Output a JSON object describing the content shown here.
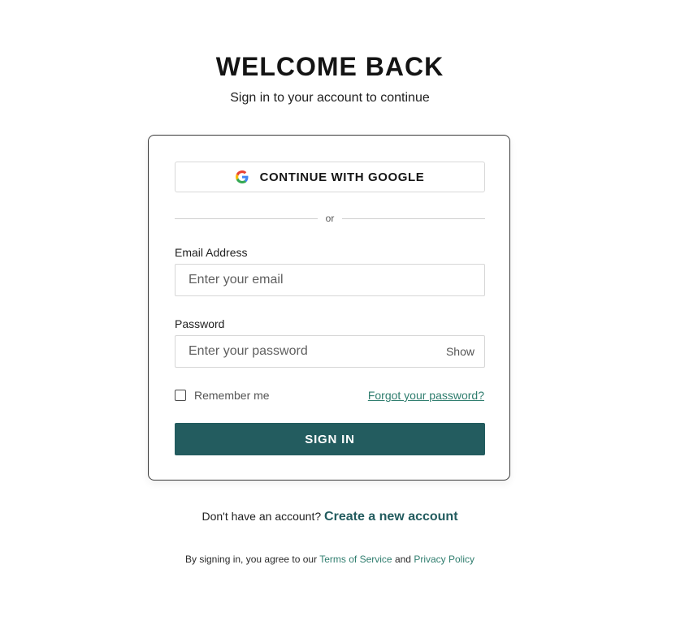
{
  "header": {
    "title": "WELCOME BACK",
    "subtitle": "Sign in to your account to continue"
  },
  "card": {
    "google_button_label": "CONTINUE WITH GOOGLE",
    "divider_text": "or",
    "email": {
      "label": "Email Address",
      "placeholder": "Enter your email"
    },
    "password": {
      "label": "Password",
      "placeholder": "Enter your password",
      "toggle_label": "Show"
    },
    "remember_label": "Remember me",
    "forgot_label": "Forgot your password?",
    "sign_in_label": "SIGN IN"
  },
  "footer": {
    "no_account_text": "Don't have an account?",
    "create_account_label": "Create a new account",
    "legal_prefix": "By signing in, you agree to our",
    "terms_label": "Terms of Service",
    "legal_and": "and",
    "privacy_label": "Privacy Policy"
  },
  "colors": {
    "primary": "#235c5f",
    "link": "#2f7d6e",
    "text": "#1c1c1c"
  },
  "icons": {
    "google": "google-icon"
  }
}
